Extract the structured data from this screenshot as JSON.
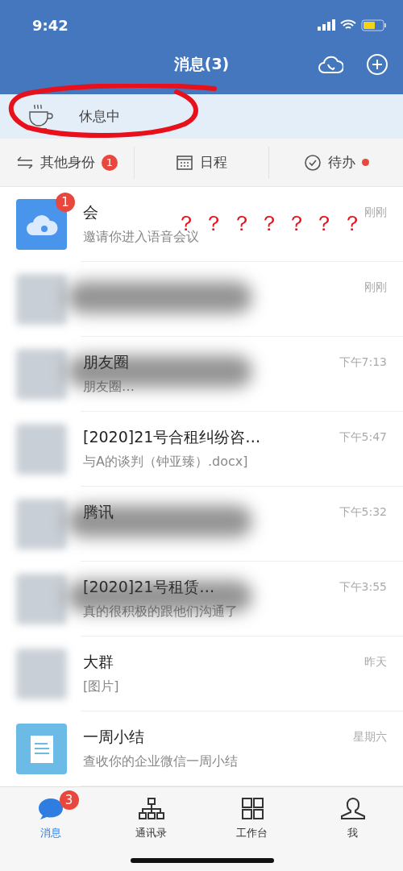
{
  "status_bar": {
    "time": "9:42"
  },
  "header": {
    "title": "消息(3)"
  },
  "status_banner": {
    "text": "休息中"
  },
  "shortcuts": [
    {
      "kind": "switch",
      "label": "其他身份",
      "badge": "1",
      "dot": false
    },
    {
      "kind": "calendar",
      "label": "日程",
      "dot": false
    },
    {
      "kind": "todo",
      "label": "待办",
      "dot": true
    }
  ],
  "conversations": [
    {
      "kind": "meeting",
      "title": "会",
      "preview": "邀请你进入语音会议",
      "time": "刚刚",
      "badge": "1",
      "smudged": false
    },
    {
      "kind": "obscured",
      "time": "刚刚",
      "smudged": true
    },
    {
      "kind": "obscured",
      "title": "朋友圈",
      "preview": "朋友圈…",
      "time": "下午7:13",
      "smudged": true
    },
    {
      "kind": "obscured",
      "title": "[2020]21号合租纠纷咨…",
      "preview": "与A的谈判（钟亚臻）.docx]",
      "time": "下午5:47",
      "smudged": false
    },
    {
      "kind": "obscured",
      "title": "腾讯",
      "time": "下午5:32",
      "smudged": true
    },
    {
      "kind": "obscured",
      "title": "[2020]21号租赁…",
      "preview": "真的很积极的跟他们沟通了",
      "time": "下午3:55",
      "smudged": true
    },
    {
      "kind": "obscured",
      "title": "大群",
      "preview": "[图片]",
      "time": "昨天",
      "smudged": false
    },
    {
      "kind": "report",
      "title": "一周小结",
      "preview": "查收你的企业微信一周小结",
      "time": "星期六",
      "smudged": false
    }
  ],
  "annotation": {
    "marks": "？ ？ ？ ？ ？ ？ ？"
  },
  "tab_bar": [
    {
      "kind": "chat",
      "label": "消息",
      "badge": "3",
      "selected": true
    },
    {
      "kind": "contacts",
      "label": "通讯录",
      "selected": false
    },
    {
      "kind": "workbench",
      "label": "工作台",
      "selected": false
    },
    {
      "kind": "me",
      "label": "我",
      "selected": false
    }
  ]
}
